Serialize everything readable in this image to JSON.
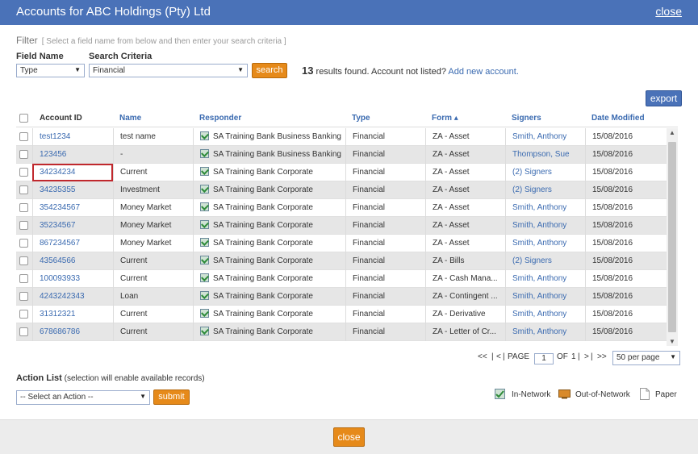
{
  "window": {
    "title": "Accounts for ABC Holdings (Pty) Ltd",
    "close_label": "close"
  },
  "filter": {
    "label": "Filter",
    "hint": "[ Select a field name from below and then enter your search criteria ]",
    "field_name_label": "Field Name",
    "field_name_value": "Type",
    "search_criteria_label": "Search Criteria",
    "search_criteria_value": "Financial",
    "search_label": "search"
  },
  "results": {
    "count": "13",
    "text": "results found. Account not listed?",
    "add_link": "Add new account."
  },
  "export_label": "export",
  "columns": [
    "Account ID",
    "Name",
    "Responder",
    "Type",
    "Form ▴",
    "Signers",
    "Date Modified"
  ],
  "rows": [
    [
      "test1234",
      "test name",
      "SA Training Bank Business Banking",
      "Financial",
      "ZA - Asset",
      "Smith, Anthony",
      "15/08/2016"
    ],
    [
      "123456",
      "-",
      "SA Training Bank Business Banking",
      "Financial",
      "ZA - Asset",
      "Thompson, Sue",
      "15/08/2016"
    ],
    [
      "34234234",
      "Current",
      "SA Training Bank Corporate",
      "Financial",
      "ZA - Asset",
      "(2) Signers",
      "15/08/2016"
    ],
    [
      "34235355",
      "Investment",
      "SA Training Bank Corporate",
      "Financial",
      "ZA - Asset",
      "(2) Signers",
      "15/08/2016"
    ],
    [
      "354234567",
      "Money Market",
      "SA Training Bank Corporate",
      "Financial",
      "ZA - Asset",
      "Smith, Anthony",
      "15/08/2016"
    ],
    [
      "35234567",
      "Money Market",
      "SA Training Bank Corporate",
      "Financial",
      "ZA - Asset",
      "Smith, Anthony",
      "15/08/2016"
    ],
    [
      "867234567",
      "Money Market",
      "SA Training Bank Corporate",
      "Financial",
      "ZA - Asset",
      "Smith, Anthony",
      "15/08/2016"
    ],
    [
      "43564566",
      "Current",
      "SA Training Bank Corporate",
      "Financial",
      "ZA - Bills",
      "(2) Signers",
      "15/08/2016"
    ],
    [
      "100093933",
      "Current",
      "SA Training Bank Corporate",
      "Financial",
      "ZA - Cash Mana...",
      "Smith, Anthony",
      "15/08/2016"
    ],
    [
      "4243242343",
      "Loan",
      "SA Training Bank Corporate",
      "Financial",
      "ZA - Contingent ...",
      "Smith, Anthony",
      "15/08/2016"
    ],
    [
      "31312321",
      "Current",
      "SA Training Bank Corporate",
      "Financial",
      "ZA - Derivative",
      "Smith, Anthony",
      "15/08/2016"
    ],
    [
      "678686786",
      "Current",
      "SA Training Bank Corporate",
      "Financial",
      "ZA - Letter of Cr...",
      "Smith, Anthony",
      "15/08/2016"
    ]
  ],
  "pager": {
    "first": "<<",
    "prev": "<",
    "page_label": "PAGE",
    "page": "1",
    "of_label": "OF",
    "total": "1",
    "next": ">",
    "last": ">>",
    "per_page": "50 per page"
  },
  "action": {
    "label": "Action List",
    "hint": "(selection will enable available records)",
    "select_value": "-- Select an Action --",
    "submit_label": "submit"
  },
  "legend": {
    "in_network": "In-Network",
    "out_of_network": "Out-of-Network",
    "paper": "Paper"
  },
  "footer": {
    "close_label": "close"
  },
  "colors": {
    "header_blue": "#4a72b8",
    "accent_orange": "#e68a1a",
    "link_blue": "#3a6ab0",
    "highlight_red": "#c0282d"
  }
}
